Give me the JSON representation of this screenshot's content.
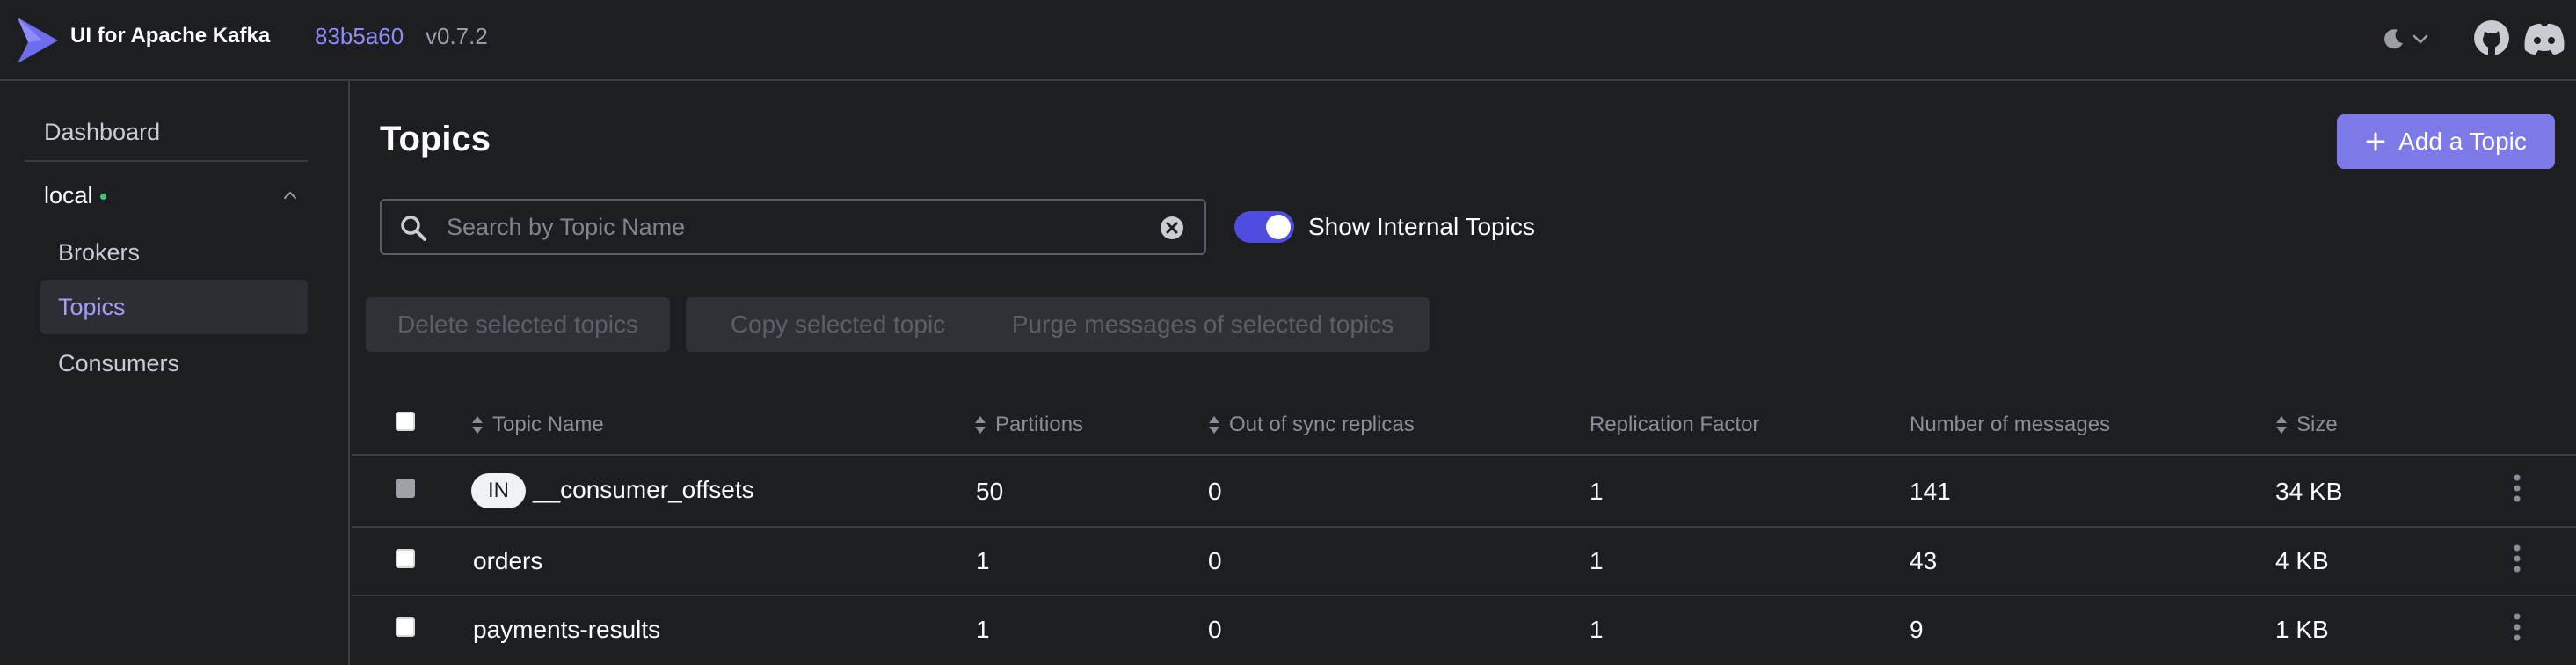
{
  "header": {
    "app_title": "UI for Apache Kafka",
    "commit": "83b5a60",
    "version": "v0.7.2",
    "icons": [
      "kafka-logo",
      "moon-icon",
      "chevron-down-icon",
      "github-icon",
      "discord-icon"
    ]
  },
  "sidebar": {
    "dashboard": "Dashboard",
    "cluster": {
      "name": "local",
      "status_color": "#3ec77a"
    },
    "items": [
      {
        "label": "Brokers",
        "active": false
      },
      {
        "label": "Topics",
        "active": true
      },
      {
        "label": "Consumers",
        "active": false
      }
    ]
  },
  "main": {
    "title": "Topics",
    "add_button": "Add a Topic",
    "search": {
      "placeholder": "Search by Topic Name",
      "value": ""
    },
    "internal_toggle": {
      "label": "Show Internal Topics",
      "on": true
    },
    "bulk_actions": [
      "Delete selected topics",
      "Copy selected topic",
      "Purge messages of selected topics"
    ]
  },
  "table": {
    "columns": [
      "Topic Name",
      "Partitions",
      "Out of sync replicas",
      "Replication Factor",
      "Number of messages",
      "Size"
    ],
    "rows": [
      {
        "badge": "IN",
        "name": "__consumer_offsets",
        "partitions": "50",
        "out_of_sync": "0",
        "replication": "1",
        "messages": "141",
        "size": "34 KB",
        "internal": true
      },
      {
        "badge": "",
        "name": "orders",
        "partitions": "1",
        "out_of_sync": "0",
        "replication": "1",
        "messages": "43",
        "size": "4 KB",
        "internal": false
      },
      {
        "badge": "",
        "name": "payments-results",
        "partitions": "1",
        "out_of_sync": "0",
        "replication": "1",
        "messages": "9",
        "size": "1 KB",
        "internal": false
      }
    ]
  },
  "colors": {
    "background": "#1d1e21",
    "accent": "#7d79e6",
    "accent_text": "#8f8cf6",
    "toggle_on": "#4f4ce0",
    "status_online": "#3ec77a"
  }
}
